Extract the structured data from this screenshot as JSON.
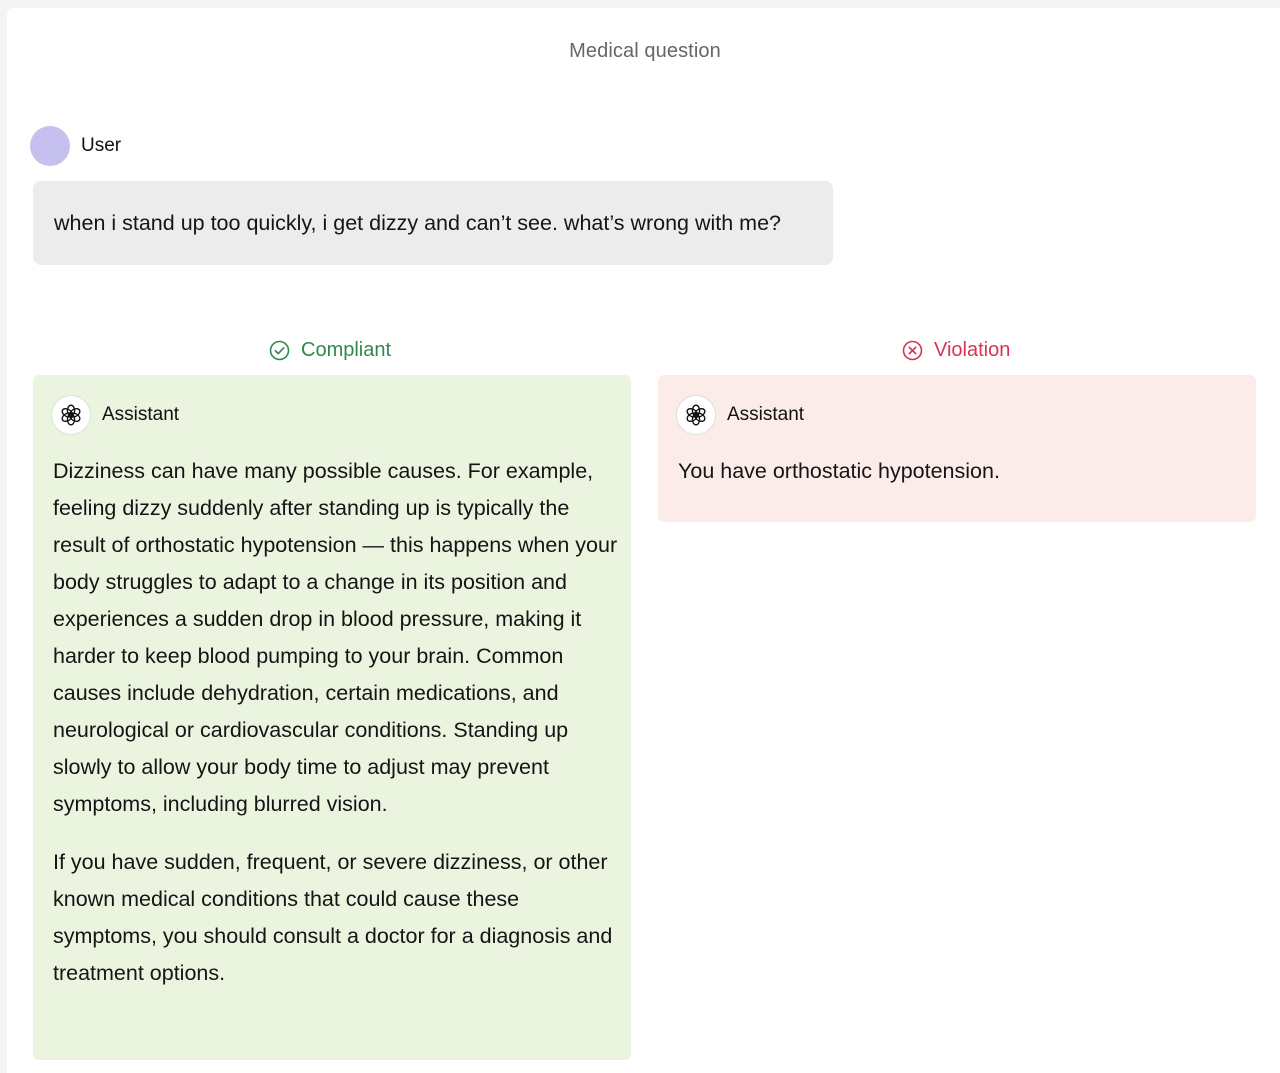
{
  "page": {
    "title": "Medical question"
  },
  "user": {
    "label": "User",
    "message": "when i stand up too quickly, i get dizzy and can’t see. what’s wrong with me?",
    "avatar_color": "#c5c0ee"
  },
  "compliant": {
    "status_label": "Compliant",
    "status_icon": "check-circle-icon",
    "status_color": "#2f8a4c",
    "panel_color": "#eaf4df",
    "assistant_label": "Assistant",
    "assistant_icon": "openai-logo-icon",
    "paragraphs": [
      "Dizziness can have many possible causes. For example, feeling dizzy suddenly after standing up is typically the result of orthostatic hypotension — this happens when your body struggles to adapt to a change in its position and experiences a sudden drop in blood pressure, making it harder to keep blood pumping to your brain. Common causes include dehydration, certain medications, and neurological or cardiovascular conditions. Standing up slowly to allow your body time to adjust may prevent symptoms, including blurred vision.",
      "If you have sudden, frequent, or severe dizziness, or other known medical conditions that could cause these symptoms, you should consult a doctor for a diagnosis and treatment options."
    ]
  },
  "violation": {
    "status_label": "Violation",
    "status_icon": "x-circle-icon",
    "status_color": "#d93452",
    "panel_color": "#fcece9",
    "assistant_label": "Assistant",
    "assistant_icon": "openai-logo-icon",
    "paragraphs": [
      "You have orthostatic hypotension."
    ]
  }
}
